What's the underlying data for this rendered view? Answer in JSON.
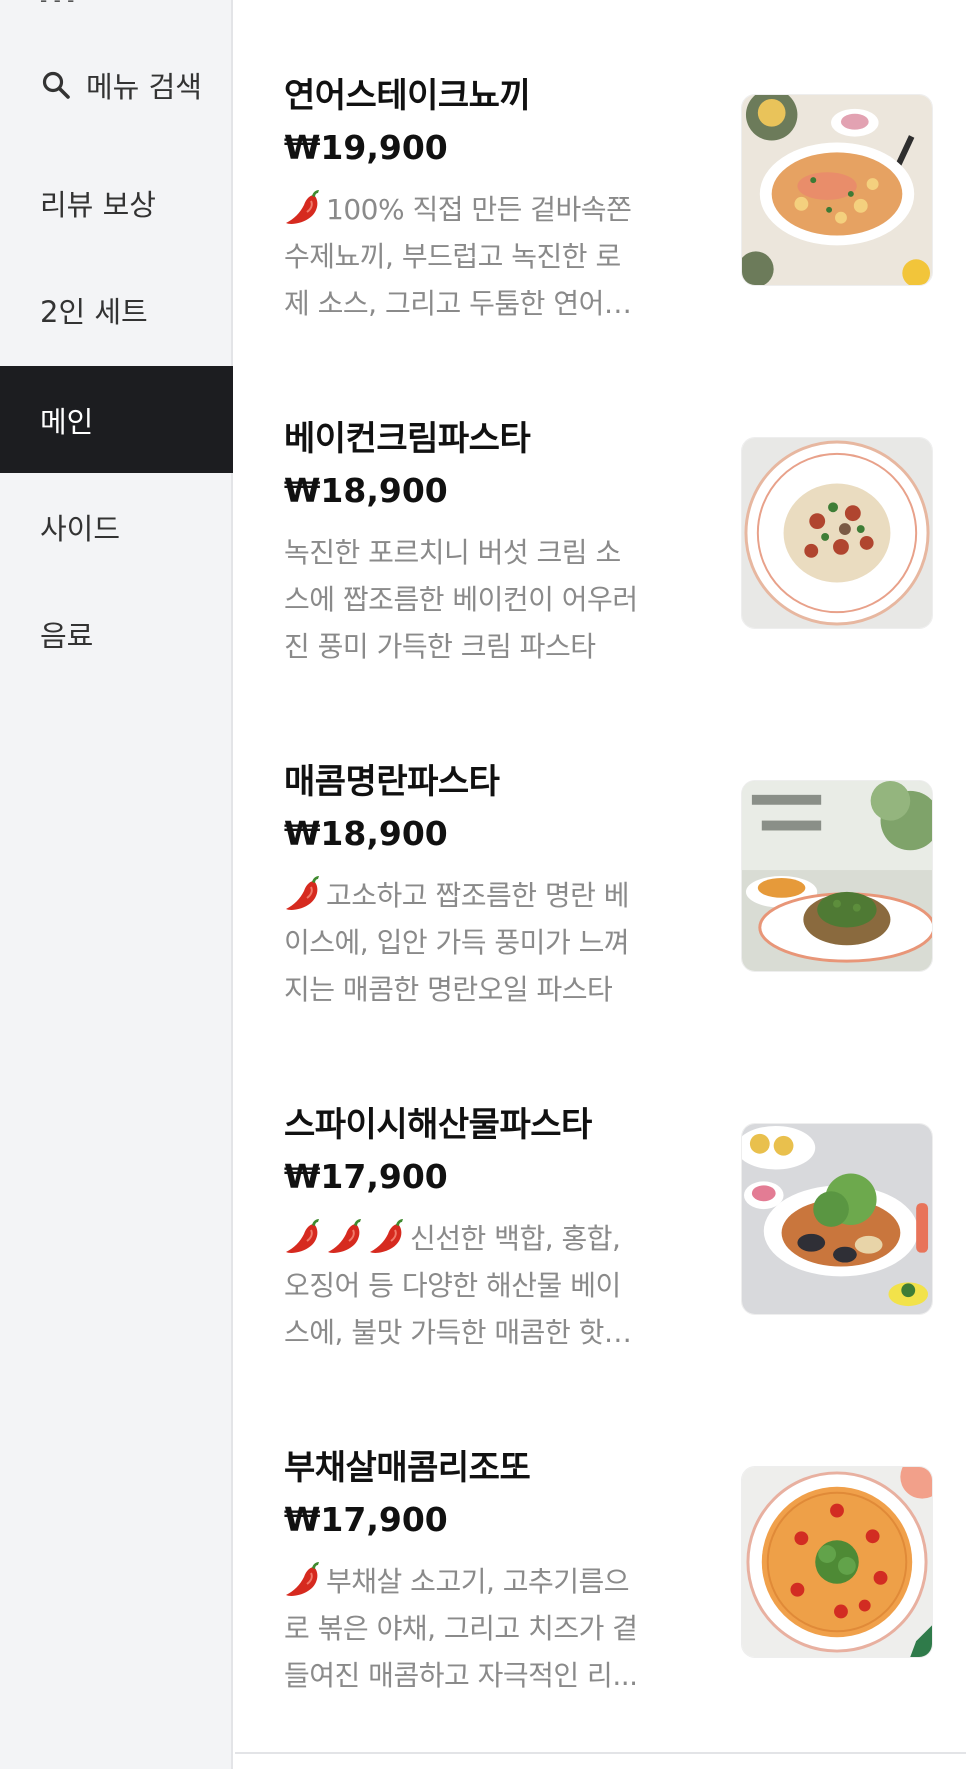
{
  "sidebar": {
    "top_fragment": "- - -",
    "items": [
      {
        "label": "메뉴 검색",
        "icon": "search-icon",
        "active": false
      },
      {
        "label": "리뷰 보상",
        "active": false
      },
      {
        "label": "2인 세트",
        "active": false
      },
      {
        "label": "메인",
        "active": true
      },
      {
        "label": "사이드",
        "active": false
      },
      {
        "label": "음료",
        "active": false
      }
    ]
  },
  "menu": {
    "items": [
      {
        "name": "연어스테이크뇨끼",
        "price": "₩19,900",
        "spicy": 1,
        "description": "100% 직접 만든 겉바속쫀 수제뇨끼, 부드럽고 녹진한 로제 소스, 그리고 두툼한 연어 스...",
        "image": "salmon-gnocchi-photo"
      },
      {
        "name": "베이컨크림파스타",
        "price": "₩18,900",
        "spicy": 0,
        "description": "녹진한 포르치니 버섯 크림 소스에 짭조름한 베이컨이 어우러진 풍미 가득한 크림 파스타",
        "image": "bacon-cream-pasta-photo"
      },
      {
        "name": "매콤명란파스타",
        "price": "₩18,900",
        "spicy": 1,
        "description": "고소하고 짭조름한 명란 베이스에, 입안 가득 풍미가 느껴지는 매콤한 명란오일 파스타",
        "image": "spicy-myeongran-pasta-photo"
      },
      {
        "name": "스파이시해산물파스타",
        "price": "₩17,900",
        "spicy": 3,
        "description": "신선한 백합, 홍합, 오징어 등 다양한 해산물 베이스에, 불맛 가득한 매콤한 핫 파...",
        "image": "spicy-seafood-pasta-photo"
      },
      {
        "name": "부채살매콤리조또",
        "price": "₩17,900",
        "spicy": 1,
        "description": "부채살 소고기, 고추기름으로 볶은 야채, 그리고 치즈가 곁들여진 매콤하고 자극적인 리...",
        "image": "beef-spicy-risotto-photo"
      }
    ]
  },
  "colors": {
    "sidebar_bg": "#f3f4f6",
    "active_bg": "#1c1d20",
    "description": "#8a8a8a",
    "pepper": "#d62a1f"
  }
}
